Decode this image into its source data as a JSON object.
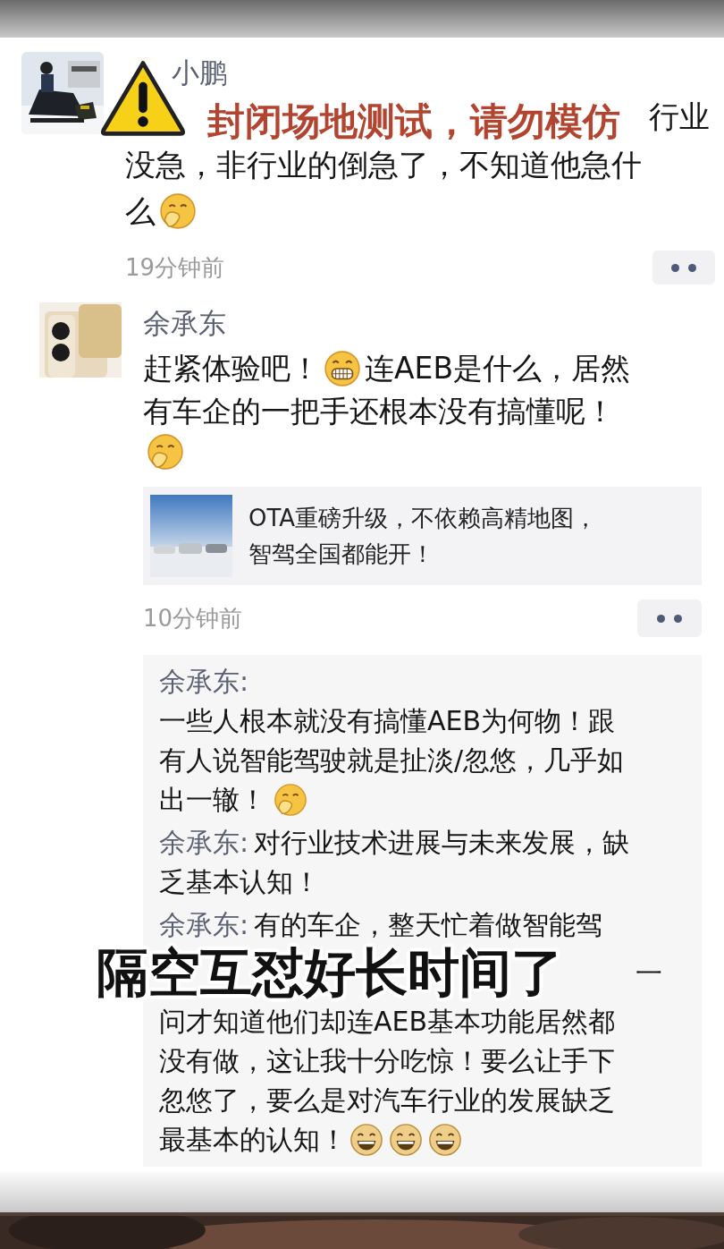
{
  "post": {
    "author": "小鹏",
    "covered_line_tail": "行业",
    "lines": [
      [
        {
          "kind": "text",
          "text": "没急，非行业的倒急了，不知道他急什"
        }
      ],
      [
        {
          "kind": "text",
          "text": "么"
        },
        {
          "kind": "cover-emoji"
        }
      ]
    ],
    "time": "19分钟前"
  },
  "comment": {
    "author": "余承东",
    "lines": [
      [
        {
          "kind": "text",
          "text": "赶紧体验吧！"
        },
        {
          "kind": "grin-emoji"
        },
        {
          "kind": "text",
          "text": "连AEB是什么，居然"
        }
      ],
      [
        {
          "kind": "text",
          "text": "有车企的一把手还根本没有搞懂呢！"
        }
      ],
      [
        {
          "kind": "cover-emoji"
        }
      ]
    ],
    "link": {
      "title_lines": [
        "OTA重磅升级，不依赖高精地图，",
        "智驾全国都能开！"
      ]
    },
    "time": "10分钟前"
  },
  "replies": [
    {
      "lines": [
        [
          {
            "kind": "author",
            "text": "余承东:"
          }
        ],
        [
          {
            "kind": "text",
            "text": "一些人根本就没有搞懂AEB为何物！跟"
          }
        ],
        [
          {
            "kind": "text",
            "text": "有人说智能驾驶就是扯淡/忽悠，几乎如"
          }
        ],
        [
          {
            "kind": "text",
            "text": "出一辙！"
          },
          {
            "kind": "cover-emoji"
          }
        ]
      ]
    },
    {
      "lines": [
        [
          {
            "kind": "author",
            "text": "余承东:"
          },
          {
            "kind": "text",
            "text": "对行业技术进展与未来发展，缺"
          }
        ],
        [
          {
            "kind": "text",
            "text": "乏基本认知！"
          }
        ]
      ]
    },
    {
      "lines": [
        [
          {
            "kind": "author",
            "text": "余承东:"
          },
          {
            "kind": "text",
            "text": "有的车企，整天忙着做智能驾"
          }
        ],
        [
          {
            "kind": "covered-tail",
            "text": "一"
          }
        ],
        [
          {
            "kind": "text",
            "text": "问才知道他们却连AEB基本功能居然都"
          }
        ],
        [
          {
            "kind": "text",
            "text": "没有做，这让我十分吃惊！要么让手下"
          }
        ],
        [
          {
            "kind": "text",
            "text": "忽悠了，要么是对汽车行业的发展缺乏"
          }
        ],
        [
          {
            "kind": "text",
            "text": "最基本的认知！"
          },
          {
            "kind": "laugh-emoji"
          },
          {
            "kind": "laugh-emoji"
          },
          {
            "kind": "laugh-emoji"
          }
        ]
      ]
    }
  ],
  "captions": [
    {
      "kind": "warning",
      "text": "封闭场地测试，请勿模仿"
    },
    {
      "kind": "subtitle",
      "text": "隔空互怼好长时间了"
    }
  ]
}
